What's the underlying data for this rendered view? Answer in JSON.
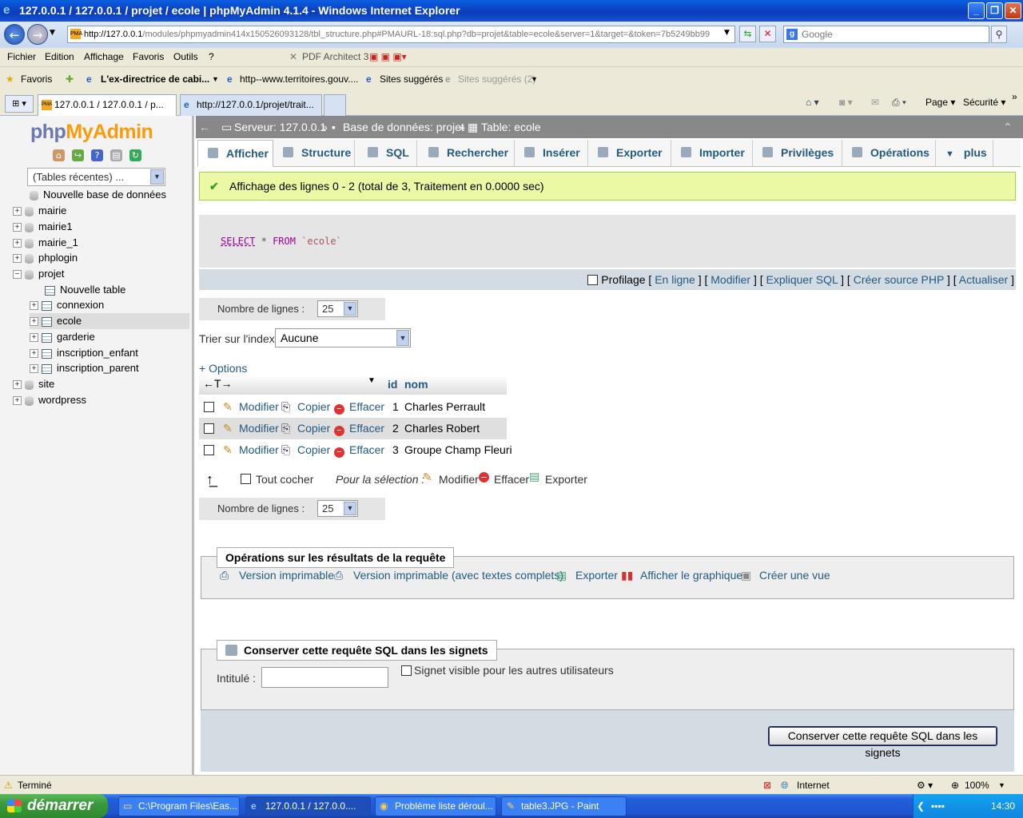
{
  "window": {
    "title": "127.0.0.1 / 127.0.0.1 / projet / ecole | phpMyAdmin 4.1.4 - Windows Internet Explorer"
  },
  "address": {
    "host": "http://127.0.0.1",
    "rest": "/modules/phpmyadmin414x150526093128/tbl_structure.php#PMAURL-18:sql.php?db=projet&table=ecole&server=1&target=&token=7b5249bb99"
  },
  "search": {
    "placeholder": "Google"
  },
  "menu": [
    "Fichier",
    "Edition",
    "Affichage",
    "Favoris",
    "Outils",
    "?"
  ],
  "pdf_architect": "PDF Architect 3",
  "favorites": {
    "label": "Favoris",
    "items": [
      "L'ex-directrice de cabi...",
      "http--www.territoires.gouv....",
      "Sites suggérés",
      "Sites suggérés (2)"
    ]
  },
  "tabs": [
    "127.0.0.1 / 127.0.0.1 / p...",
    "http://127.0.0.1/projet/trait..."
  ],
  "ie_tools": {
    "page": "Page",
    "security": "Sécurité"
  },
  "pma": {
    "logo_a": "php",
    "logo_b": "MyAdmin",
    "recent": "(Tables récentes) ...",
    "tree": {
      "new_db": "Nouvelle base de données",
      "dbs_top": [
        "mairie",
        "mairie1",
        "mairie_1",
        "phplogin",
        "projet"
      ],
      "new_table": "Nouvelle table",
      "tables": [
        "connexion",
        "ecole",
        "garderie",
        "inscription_enfant",
        "inscription_parent"
      ],
      "dbs_bottom": [
        "site",
        "wordpress"
      ]
    },
    "breadcrumb": {
      "server": "Serveur: 127.0.0.1",
      "sep1": "»",
      "db": "Base de données: projet",
      "sep2": "»",
      "table": "Table: ecole"
    },
    "tabs": [
      "Afficher",
      "Structure",
      "SQL",
      "Rechercher",
      "Insérer",
      "Exporter",
      "Importer",
      "Privilèges",
      "Opérations",
      "plus"
    ],
    "success": "Affichage des lignes 0 - 2 (total de 3, Traitement en 0.0000 sec)",
    "sql": {
      "select": "SELECT",
      "star": "*",
      "from": "FROM",
      "table": "`ecole`"
    },
    "sql_links": {
      "profilage": "Profilage",
      "inline": "En ligne",
      "modifier": "Modifier",
      "expliquer": "Expliquer SQL",
      "source": "Créer source PHP",
      "actualiser": "Actualiser"
    },
    "nb_lignes_label": "Nombre de lignes :",
    "nb_lignes_value": "25",
    "trier_label": "Trier sur l'index:",
    "trier_value": "Aucune",
    "options": "+ Options",
    "arrows": "←T→",
    "columns": {
      "id": "id",
      "nom": "nom"
    },
    "row_actions": {
      "edit": "Modifier",
      "copy": "Copier",
      "delete": "Effacer"
    },
    "rows": [
      {
        "id": "1",
        "nom": "Charles Perrault"
      },
      {
        "id": "2",
        "nom": "Charles Robert"
      },
      {
        "id": "3",
        "nom": "Groupe Champ Fleuri"
      }
    ],
    "check_all": "Tout cocher",
    "for_selection": "Pour la sélection :",
    "sel_actions": {
      "edit": "Modifier",
      "delete": "Effacer",
      "export": "Exporter"
    },
    "ops_title": "Opérations sur les résultats de la requête",
    "ops": [
      "Version imprimable",
      "Version imprimable (avec textes complets)",
      "Exporter",
      "Afficher le graphique",
      "Créer une vue"
    ],
    "bookmark_title": "Conserver cette requête SQL dans les signets",
    "intitule": "Intitulé :",
    "visible": "Signet visible pour les autres utilisateurs",
    "save_btn": "Conserver cette requête SQL dans les signets"
  },
  "status": {
    "text": "Terminé",
    "zone": "Internet",
    "zoom": "100%"
  },
  "taskbar": {
    "start": "démarrer",
    "tasks": [
      "C:\\Program Files\\Eas...",
      "127.0.0.1 / 127.0.0....",
      "Problème liste déroul...",
      "table3.JPG - Paint"
    ],
    "clock": "14:30"
  }
}
